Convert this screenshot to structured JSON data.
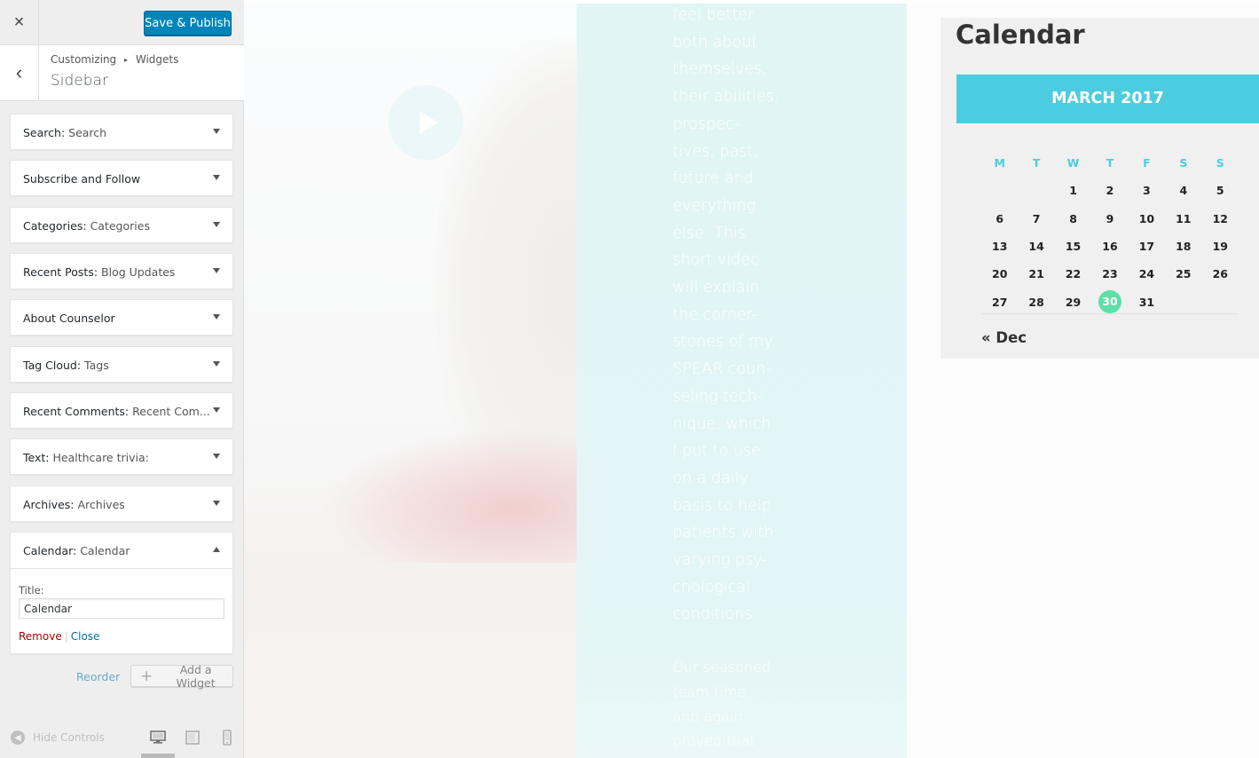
{
  "header": {
    "close_icon": "×",
    "save_label": "Save & Publish"
  },
  "section": {
    "back_icon": "‹",
    "breadcrumb_parent": "Customizing",
    "breadcrumb_sep": "▸",
    "breadcrumb_child": "Widgets",
    "title": "Sidebar"
  },
  "widgets": [
    {
      "type": "Search:",
      "title": "Search"
    },
    {
      "type": "Subscribe and Follow",
      "title": ""
    },
    {
      "type": "Categories:",
      "title": "Categories"
    },
    {
      "type": "Recent Posts:",
      "title": "Blog Updates"
    },
    {
      "type": "About Counselor",
      "title": ""
    },
    {
      "type": "Tag Cloud:",
      "title": "Tags"
    },
    {
      "type": "Recent Comments:",
      "title": "Recent Com..."
    },
    {
      "type": "Text:",
      "title": "Healthcare trivia:"
    },
    {
      "type": "Archives:",
      "title": "Archives"
    },
    {
      "type": "Calendar:",
      "title": "Calendar"
    }
  ],
  "calendar_form": {
    "title_label": "Title:",
    "title_value": "Calendar",
    "remove_label": "Remove",
    "separator": "|",
    "close_label": "Close"
  },
  "sidebar_actions": {
    "reorder_label": "Reorder",
    "add_widget_label": "Add a Widget",
    "add_icon": "+"
  },
  "footer": {
    "hide_controls_label": "Hide Controls"
  },
  "preview": {
    "panel_text_lines": [
      "feel better",
      "both about",
      "themselves,",
      "their abilities,",
      "prospec-",
      "tives, past,",
      "future and",
      "everything",
      "else. This",
      "short video",
      "will explain",
      "the corner-",
      "stones of my",
      "SPEAR coun-",
      "seling tech-",
      "nique, which",
      "I put to use",
      "on a daily",
      "basis to help",
      "patients with",
      "varying psy-",
      "chological",
      "conditions."
    ],
    "panel_text2_lines": [
      "Our seasoned",
      "team time",
      "and again",
      "proved that"
    ],
    "calendar_title": "Calendar",
    "calendar_month": "MARCH 2017",
    "calendar_days": [
      "M",
      "T",
      "W",
      "T",
      "F",
      "S",
      "S"
    ],
    "calendar_weeks": [
      [
        "",
        "",
        "1",
        "2",
        "3",
        "4",
        "5"
      ],
      [
        "6",
        "7",
        "8",
        "9",
        "10",
        "11",
        "12"
      ],
      [
        "13",
        "14",
        "15",
        "16",
        "17",
        "18",
        "19"
      ],
      [
        "20",
        "21",
        "22",
        "23",
        "24",
        "25",
        "26"
      ],
      [
        "27",
        "28",
        "29",
        "30",
        "31",
        "",
        ""
      ]
    ],
    "calendar_today": "30",
    "calendar_prev": "« Dec"
  },
  "colors": {
    "primary_button": "#0085ba",
    "calendar_accent": "#4ccddf",
    "today_highlight": "#5ddfa6",
    "remove_link": "#a00",
    "link": "#0073aa"
  }
}
